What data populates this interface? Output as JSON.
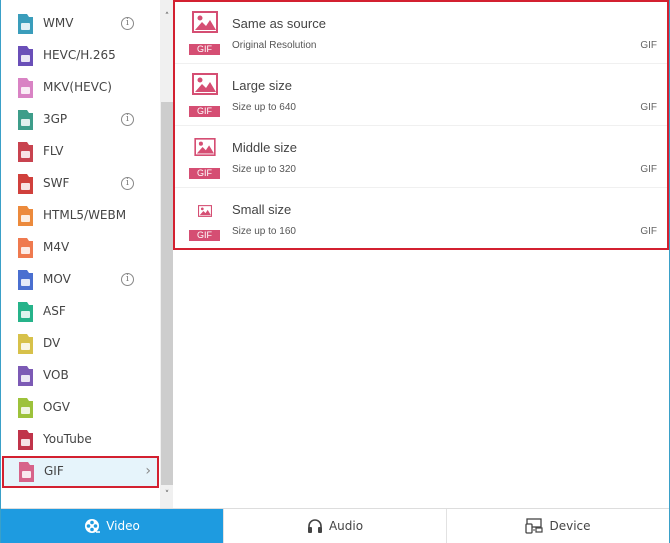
{
  "formats": [
    {
      "label": "WMV",
      "icon": "wmv-file-icon",
      "color": "#3a9dbb",
      "info": true
    },
    {
      "label": "HEVC/H.265",
      "icon": "hevc-file-icon",
      "color": "#6a4fb8",
      "info": false
    },
    {
      "label": "MKV(HEVC)",
      "icon": "mkv-file-icon",
      "color": "#d983c4",
      "info": false
    },
    {
      "label": "3GP",
      "icon": "3gp-file-icon",
      "color": "#3e9d8a",
      "info": true
    },
    {
      "label": "FLV",
      "icon": "flv-file-icon",
      "color": "#c8434f",
      "info": false
    },
    {
      "label": "SWF",
      "icon": "swf-file-icon",
      "color": "#d0403c",
      "info": true
    },
    {
      "label": "HTML5/WEBM",
      "icon": "html5-file-icon",
      "color": "#ec8a3c",
      "info": false
    },
    {
      "label": "M4V",
      "icon": "m4v-file-icon",
      "color": "#ef7a4f",
      "info": false
    },
    {
      "label": "MOV",
      "icon": "mov-file-icon",
      "color": "#4a6fd0",
      "info": true
    },
    {
      "label": "ASF",
      "icon": "asf-file-icon",
      "color": "#26b38a",
      "info": false
    },
    {
      "label": "DV",
      "icon": "dv-file-icon",
      "color": "#d7c14a",
      "info": false
    },
    {
      "label": "VOB",
      "icon": "vob-file-icon",
      "color": "#7c5ab5",
      "info": false
    },
    {
      "label": "OGV",
      "icon": "ogv-file-icon",
      "color": "#9dc23b",
      "info": false
    },
    {
      "label": "YouTube",
      "icon": "youtube-file-icon",
      "color": "#c0344a",
      "info": false
    },
    {
      "label": "GIF",
      "icon": "gif-file-icon",
      "color": "#d7638a",
      "info": false,
      "selected": true
    }
  ],
  "info_glyph": "i",
  "chevron_glyph": "›",
  "scroll_up_glyph": "˄",
  "scroll_down_glyph": "˅",
  "presets": [
    {
      "title": "Same as source",
      "subtitle": "Original Resolution",
      "format": "GIF",
      "badge": "GIF",
      "icon_size": "large"
    },
    {
      "title": "Large size",
      "subtitle": "Size up to 640",
      "format": "GIF",
      "badge": "GIF",
      "icon_size": "large"
    },
    {
      "title": "Middle size",
      "subtitle": "Size up to 320",
      "format": "GIF",
      "badge": "GIF",
      "icon_size": "medium"
    },
    {
      "title": "Small size",
      "subtitle": "Size up to 160",
      "format": "GIF",
      "badge": "GIF",
      "icon_size": "small"
    }
  ],
  "tabs": [
    {
      "label": "Video",
      "icon": "film-reel-icon",
      "active": true
    },
    {
      "label": "Audio",
      "icon": "headphones-icon",
      "active": false
    },
    {
      "label": "Device",
      "icon": "device-icon",
      "active": false
    }
  ],
  "colors": {
    "accent": "#1e9be0",
    "highlight_border": "#d32030",
    "gif_badge": "#d54e73",
    "selected_bg": "#e6f4fb"
  }
}
